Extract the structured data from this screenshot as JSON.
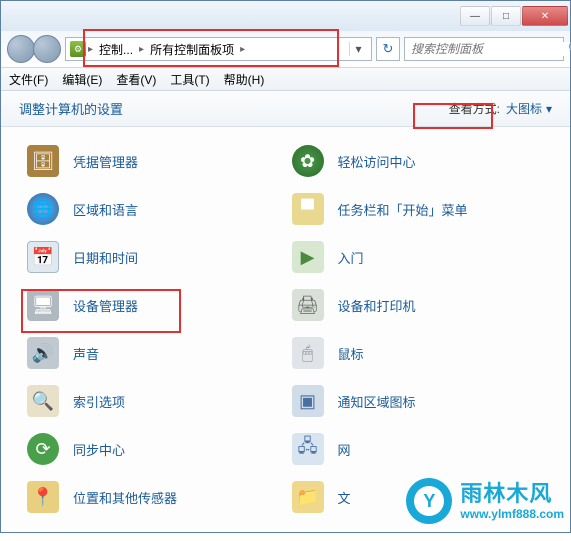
{
  "titlebar": {
    "minimize_glyph": "—",
    "maximize_glyph": "□",
    "close_glyph": "✕"
  },
  "address": {
    "seg1": "控制...",
    "seg2": "所有控制面板项",
    "refresh_glyph": "↻"
  },
  "search": {
    "placeholder": "搜索控制面板",
    "glyph": "🔍"
  },
  "menubar": {
    "file": "文件(F)",
    "edit": "编辑(E)",
    "view": "查看(V)",
    "tools": "工具(T)",
    "help": "帮助(H)"
  },
  "toolbar": {
    "title": "调整计算机的设置",
    "viewby_label": "查看方式:",
    "viewby_value": "大图标"
  },
  "items": [
    {
      "label": "凭据管理器",
      "name": "credential-manager",
      "cls": "ic-cred",
      "glyph": "🗄"
    },
    {
      "label": "轻松访问中心",
      "name": "ease-of-access",
      "cls": "ic-ease",
      "glyph": "✿"
    },
    {
      "label": "区域和语言",
      "name": "region-language",
      "cls": "ic-region",
      "glyph": "🌐"
    },
    {
      "label": "任务栏和「开始」菜单",
      "name": "taskbar-start-menu",
      "cls": "ic-taskbar",
      "glyph": "▀"
    },
    {
      "label": "日期和时间",
      "name": "date-time",
      "cls": "ic-datetime",
      "glyph": "📅"
    },
    {
      "label": "入门",
      "name": "getting-started",
      "cls": "ic-getstart",
      "glyph": "▶"
    },
    {
      "label": "设备管理器",
      "name": "device-manager",
      "cls": "ic-devmgr",
      "glyph": "🖥"
    },
    {
      "label": "设备和打印机",
      "name": "devices-printers",
      "cls": "ic-printer",
      "glyph": "🖨"
    },
    {
      "label": "声音",
      "name": "sound",
      "cls": "ic-sound",
      "glyph": "🔊"
    },
    {
      "label": "鼠标",
      "name": "mouse",
      "cls": "ic-mouse",
      "glyph": "🖱"
    },
    {
      "label": "索引选项",
      "name": "indexing-options",
      "cls": "ic-index",
      "glyph": "🔍"
    },
    {
      "label": "通知区域图标",
      "name": "notification-icons",
      "cls": "ic-notif",
      "glyph": "▣"
    },
    {
      "label": "同步中心",
      "name": "sync-center",
      "cls": "ic-sync",
      "glyph": "⟳"
    },
    {
      "label": "网",
      "name": "network",
      "cls": "ic-net",
      "glyph": "🖧"
    },
    {
      "label": "位置和其他传感器",
      "name": "location-sensors",
      "cls": "ic-loc",
      "glyph": "📍"
    },
    {
      "label": "文",
      "name": "file-cut",
      "cls": "ic-file",
      "glyph": "📁"
    }
  ],
  "watermark": {
    "logo_glyph": "Y",
    "text": "雨林木风",
    "url": "www.ylmf888.com"
  }
}
